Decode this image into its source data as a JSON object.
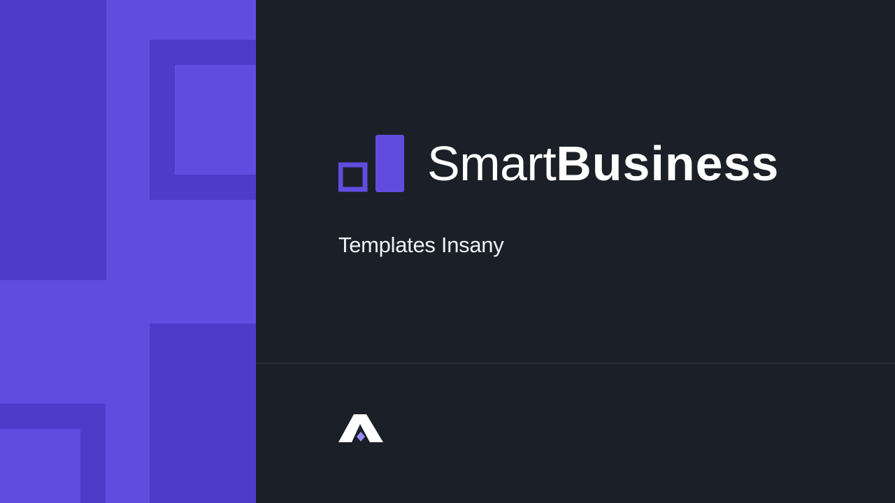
{
  "brand": {
    "name_light": "Smart",
    "name_bold": "Business",
    "subtitle": "Templates Insany"
  },
  "colors": {
    "accent": "#624ce0",
    "accent_dark": "#4e3bc9",
    "background": "#1b2028",
    "text": "#ffffff",
    "footer_logo_diamond": "#9d8cf5"
  },
  "icons": {
    "brand_logo": "bar-chart-logo-icon",
    "footer_logo": "triangle-a-logo-icon"
  }
}
